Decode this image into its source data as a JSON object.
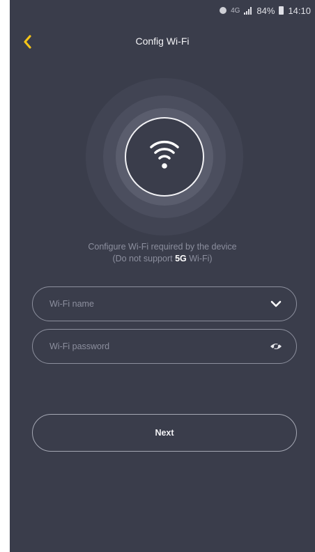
{
  "status_bar": {
    "network": "4G",
    "battery": "84%",
    "time": "14:10"
  },
  "header": {
    "title": "Config Wi-Fi",
    "back_icon": "chevron-left-icon",
    "accent_color": "#f5c518"
  },
  "graphic": {
    "icon": "wifi-icon"
  },
  "instructions": {
    "line1": "Configure Wi-Fi required by the device",
    "line2_prefix": "(Do not support ",
    "line2_bold": "5G",
    "line2_suffix": " Wi-Fi)"
  },
  "form": {
    "wifi_name_placeholder": "Wi-Fi name",
    "wifi_name_value": "",
    "wifi_name_icon": "chevron-down-icon",
    "wifi_password_placeholder": "Wi-Fi password",
    "wifi_password_value": "",
    "wifi_password_icon": "eye-hidden-icon"
  },
  "actions": {
    "next_label": "Next"
  },
  "colors": {
    "background": "#3a3d4b",
    "border": "#8d909e",
    "muted_text": "#8c8f9e"
  }
}
